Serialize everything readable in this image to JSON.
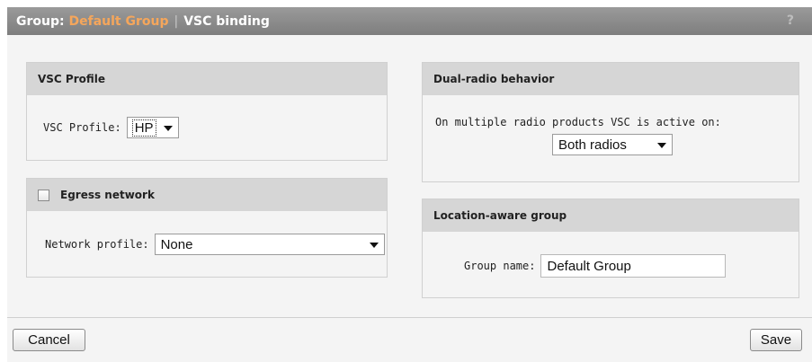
{
  "header": {
    "prefix": "Group:",
    "group_name": "Default Group",
    "separator": "|",
    "page": "VSC binding",
    "help": "?"
  },
  "vsc_profile": {
    "title": "VSC Profile",
    "label": "VSC Profile:",
    "value": "HP"
  },
  "egress": {
    "title": "Egress network",
    "checked": false,
    "label": "Network profile:",
    "value": "None"
  },
  "dual_radio": {
    "title": "Dual-radio behavior",
    "label": "On multiple radio products VSC is active on:",
    "value": "Both radios"
  },
  "location": {
    "title": "Location-aware group",
    "label": "Group name:",
    "value": "Default Group"
  },
  "buttons": {
    "cancel": "Cancel",
    "save": "Save"
  },
  "colors": {
    "title_accent": "#f5a65b",
    "titlebar": "#888888",
    "panel_header": "#d6d6d6"
  }
}
